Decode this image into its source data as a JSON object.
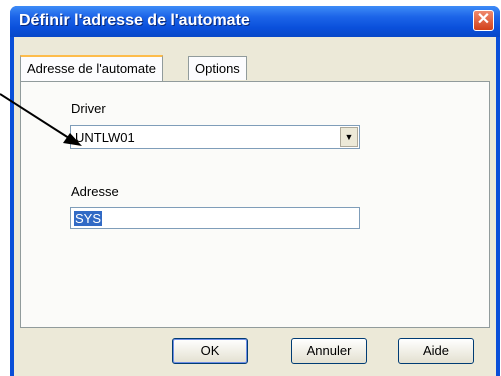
{
  "window": {
    "title": "Définir l'adresse de l'automate",
    "close_glyph": "✕"
  },
  "tabs": [
    {
      "label": "Adresse de l'automate",
      "active": true
    },
    {
      "label": "Options",
      "active": false
    }
  ],
  "driver": {
    "label": "Driver",
    "value": "UNTLW01"
  },
  "address": {
    "label": "Adresse",
    "value": "SYS"
  },
  "buttons": {
    "ok": "OK",
    "cancel": "Annuler",
    "help": "Aide"
  }
}
